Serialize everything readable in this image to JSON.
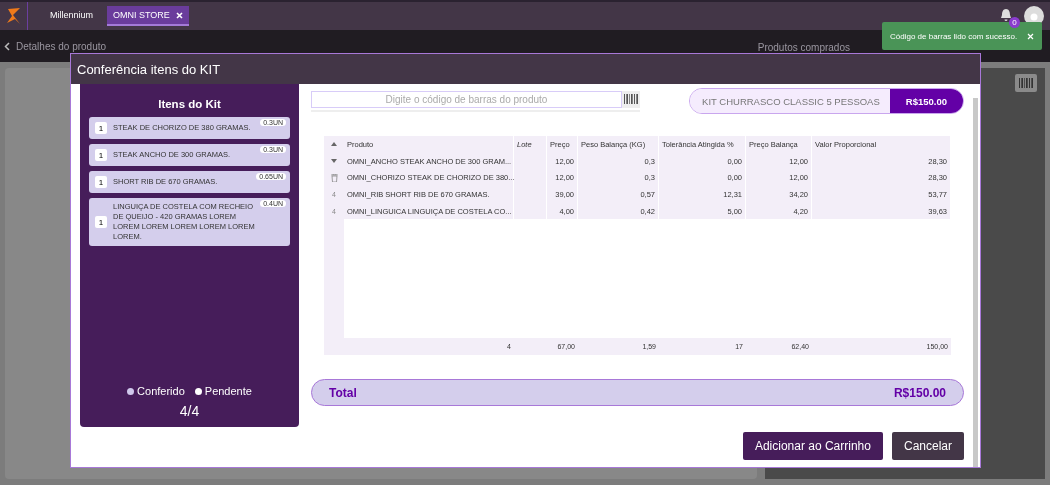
{
  "app_bar": {
    "tabs": [
      {
        "label": "Millennium",
        "selected": false,
        "closable": false
      },
      {
        "label": "OMNI STORE",
        "selected": true,
        "closable": true
      }
    ],
    "notification_count": "0"
  },
  "sub_bar": {
    "back_label": "Detalhes do produto",
    "right_label": "Produtos comprados"
  },
  "toast": {
    "message": "Código de barras lido com sucesso."
  },
  "dialog": {
    "title": "Conferência itens do KIT",
    "kit_panel": {
      "title": "Itens do Kit",
      "items": [
        {
          "qty": "1",
          "name": "STEAK DE CHORIZO DE 380 GRAMAS.",
          "badge": "0.3UN"
        },
        {
          "qty": "1",
          "name": "STEAK ANCHO DE 300 GRAMAS.",
          "badge": "0.3UN"
        },
        {
          "qty": "1",
          "name": "SHORT RIB DE 670 GRAMAS.",
          "badge": "0.65UN"
        },
        {
          "qty": "1",
          "name": "LINGUIÇA DE COSTELA COM RECHEIO DE QUEIJO - 420 GRAMAS LOREM LOREM LOREM LOREM LOREM LOREM LOREM.",
          "badge": "0.4UN"
        }
      ],
      "legend": [
        {
          "label": "Conferido",
          "color": "#d0c8ec"
        },
        {
          "label": "Pendente",
          "color": "#ffffff"
        }
      ],
      "count": "4/4"
    },
    "search": {
      "placeholder": "Digite o código de barras do produto"
    },
    "kit": {
      "name": "KIT CHURRASCO CLASSIC 5 PESSOAS",
      "price": "R$150.00"
    },
    "table": {
      "columns": [
        "Produto",
        "Lote",
        "Preço",
        "Peso Balança (KG)",
        "Tolerância Atingida %",
        "Preço Balança",
        "Valor Proporcional"
      ],
      "rows": [
        {
          "kind": "caret",
          "cells": [
            "OMNI_ANCHO STEAK ANCHO DE 300 GRAM...",
            null,
            "12,00",
            "0,3",
            "0,00",
            "12,00",
            "28,30"
          ]
        },
        {
          "kind": "trash",
          "cells": [
            "OMNI_CHORIZO STEAK DE CHORIZO DE 380...",
            null,
            "12,00",
            "0,3",
            "0,00",
            "12,00",
            "28,30"
          ]
        },
        {
          "kind": "text",
          "gutter_text": "4",
          "cells": [
            "OMNI_RIB SHORT RIB DE 670 GRAMAS.",
            null,
            "39,00",
            "0,57",
            "12,31",
            "34,20",
            "53,77"
          ]
        },
        {
          "kind": "text",
          "gutter_text": "4",
          "cells": [
            "OMNI_LINGUICA LINGUIÇA DE COSTELA CO...",
            null,
            "4,00",
            "0,42",
            "5,00",
            "4,20",
            "39,63"
          ]
        }
      ],
      "footer": {
        "produto": "4",
        "preco": "67,00",
        "peso_balanca": "1,59",
        "tolerancia": "17",
        "preco_balanca": "62,40",
        "valor_proporcional": "150,00"
      }
    },
    "total": {
      "label": "Total",
      "value": "R$150.00"
    },
    "buttons": [
      {
        "label": "Adicionar ao Carrinho",
        "kind": "primary"
      },
      {
        "label": "Cancelar",
        "kind": "secondary"
      }
    ]
  }
}
